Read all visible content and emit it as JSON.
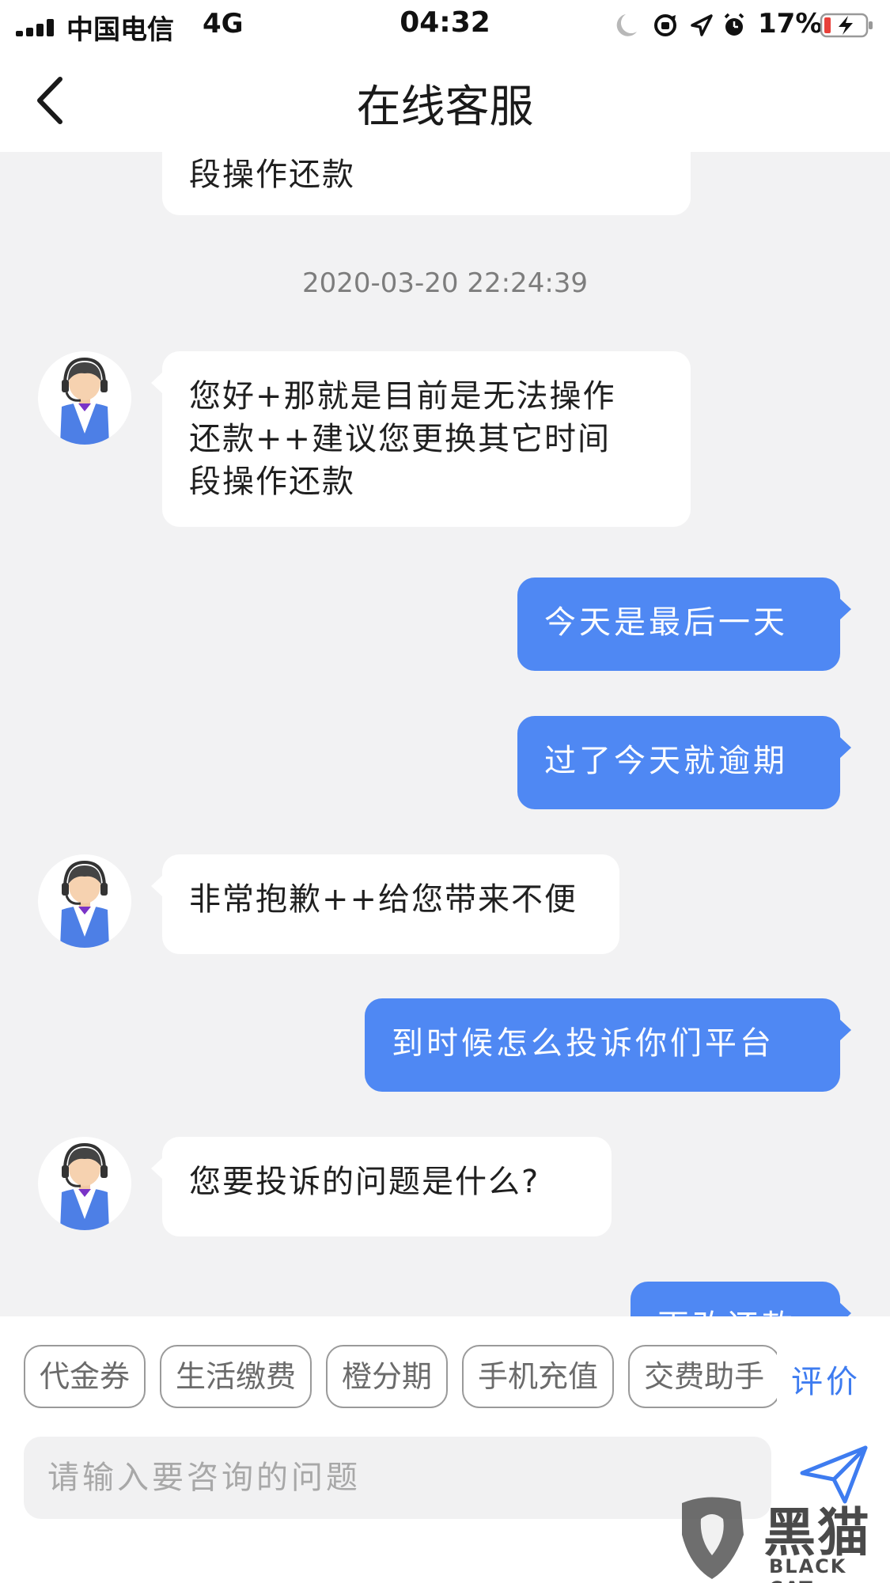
{
  "status_bar": {
    "carrier": "中国电信",
    "network": "4G",
    "time": "04:32",
    "battery_percent": "17%",
    "icons": [
      "moon-icon",
      "rotation-lock-icon",
      "location-icon",
      "alarm-icon"
    ]
  },
  "nav": {
    "title": "在线客服"
  },
  "messages": [
    {
      "side": "in",
      "lines": [
        "段操作还款"
      ],
      "partial": true
    },
    {
      "type": "timestamp",
      "text": "2020-03-20 22:24:39"
    },
    {
      "side": "in",
      "lines": [
        "您好+那就是目前是无法操作",
        "还款++建议您更换其它时间",
        "段操作还款"
      ]
    },
    {
      "side": "out",
      "lines": [
        "今天是最后一天"
      ]
    },
    {
      "side": "out",
      "lines": [
        "过了今天就逾期"
      ]
    },
    {
      "side": "in",
      "lines": [
        "非常抱歉++给您带来不便"
      ]
    },
    {
      "side": "out",
      "lines": [
        "到时候怎么投诉你们平台"
      ]
    },
    {
      "side": "in",
      "lines": [
        "您要投诉的问题是什么?"
      ]
    },
    {
      "side": "out",
      "lines": [
        "更改还款"
      ],
      "partial": true
    }
  ],
  "quick_replies": [
    "代金券",
    "生活缴费",
    "橙分期",
    "手机充值",
    "交费助手"
  ],
  "rate_label": "评价",
  "input": {
    "placeholder": "请输入要咨询的问题",
    "value": ""
  },
  "watermark": {
    "glyphs": "黑猫",
    "text": "BLACK CAT"
  },
  "colors": {
    "outgoing_bubble": "#4f88f3",
    "incoming_bubble": "#ffffff",
    "accent": "#3e7cf0",
    "background": "#f2f2f3"
  }
}
